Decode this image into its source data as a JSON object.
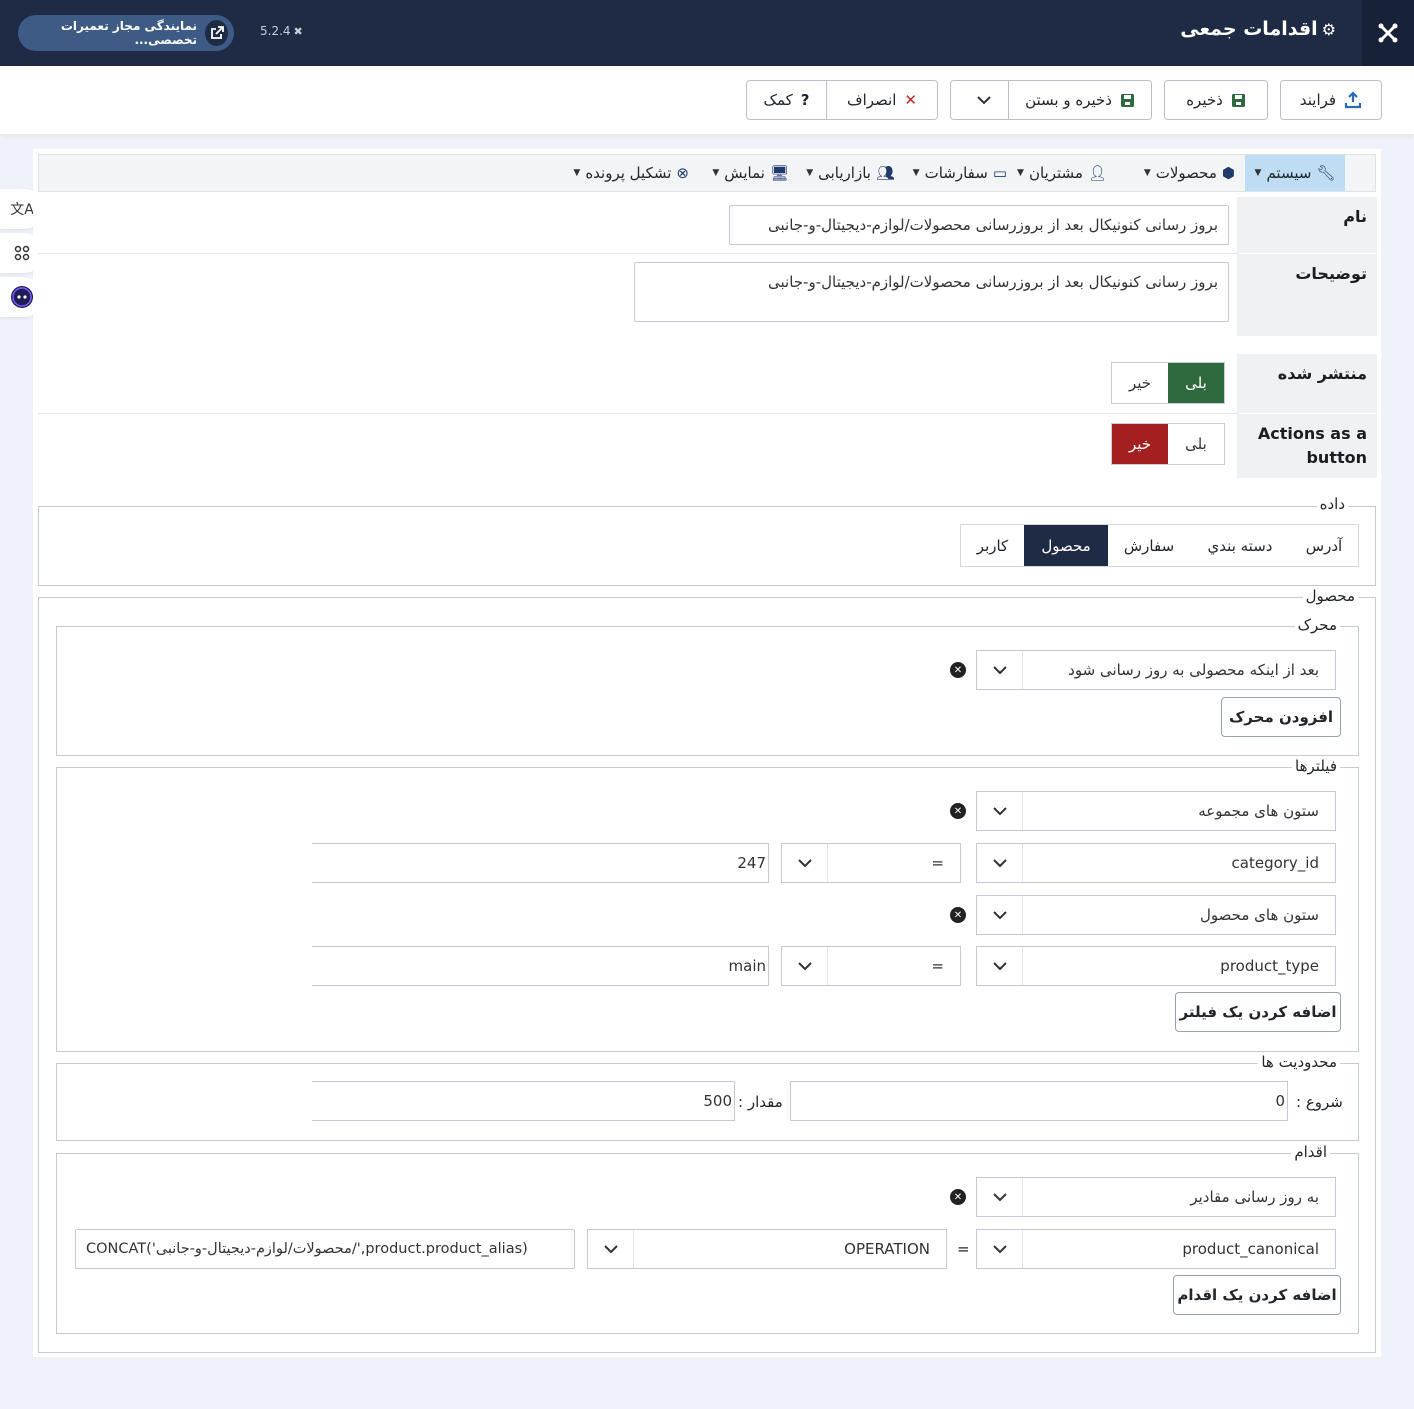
{
  "header": {
    "title": "اقدامات جمعی",
    "site_name": "نمایندگی مجاز تعمیرات تخصصی...",
    "version": "5.2.4"
  },
  "toolbar": {
    "process": "فرایند",
    "save": "ذخیره",
    "save_close": "ذخیره و بستن",
    "cancel": "انصراف",
    "help": "کمک"
  },
  "menu": {
    "items": [
      {
        "label": "سیستم",
        "icon": "wrench-icon"
      },
      {
        "label": "محصولات",
        "icon": "cubes-icon"
      },
      {
        "label": "مشتریان",
        "icon": "user-icon"
      },
      {
        "label": "سفارشات",
        "icon": "credit-card-icon"
      },
      {
        "label": "بازاریابی",
        "icon": "users-icon"
      },
      {
        "label": "نمایش",
        "icon": "desktop-icon"
      },
      {
        "label": "تشکیل پرونده",
        "icon": "life-ring-icon"
      }
    ]
  },
  "form": {
    "name_label": "نام",
    "name_value": "بروز رسانی کنونیکال بعد از بروزرسانی محصولات/لوازم-دیجیتال-و-جانبی",
    "desc_label": "توضیحات",
    "desc_value": "بروز رسانی کنونیکال بعد از بروزرسانی محصولات/لوازم-دیجیتال-و-جانبی",
    "published_label": "منتشر شده",
    "actions_label": "Actions as a button",
    "yes": "بلی",
    "no": "خیر"
  },
  "data_section": {
    "legend": "داده",
    "tabs": [
      "آدرس",
      "دسته بندي",
      "سفارش",
      "محصول",
      "کاربر"
    ],
    "active_tab": "محصول"
  },
  "product": {
    "legend": "محصول",
    "trigger": {
      "legend": "محرک",
      "select_value": "بعد از اینکه محصولی به روز رسانی شود",
      "add_button": "افزودن محرک"
    },
    "filters": {
      "legend": "فیلترها",
      "group1_table": "ستون های مجموعه",
      "group1_column": "category_id",
      "group1_operator": "=",
      "group1_value": "247",
      "group2_table": "ستون های محصول",
      "group2_column": "product_type",
      "group2_operator": "=",
      "group2_value": "main",
      "add_button": "اضافه کردن یک فیلتر"
    },
    "limits": {
      "legend": "محدودیت ها",
      "start_label": "شروع :",
      "start_value": "0",
      "amount_label": "مقدار :",
      "amount_value": "500"
    },
    "action": {
      "legend": "اقدام",
      "select_value": "به روز رسانی مقادیر",
      "column": "product_canonical",
      "equals": "=",
      "operation": "OPERATION",
      "expression": "CONCAT('محصولات/لوازم-دیجیتال-و-جانبی/',product.product_alias)",
      "add_button": "اضافه کردن یک اقدام"
    }
  }
}
